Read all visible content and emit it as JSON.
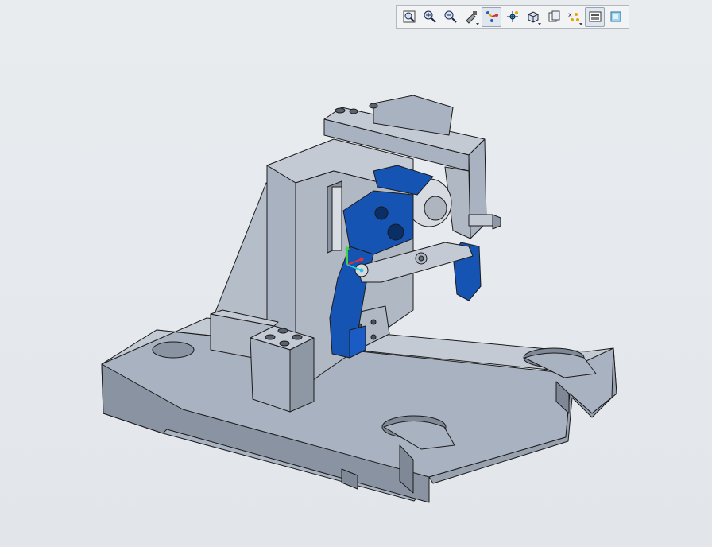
{
  "viewer": {
    "toolbar": [
      {
        "id": "refit",
        "icon": "zoom-fit-icon",
        "has_menu": false,
        "active": false
      },
      {
        "id": "zoom_in",
        "icon": "zoom-in-icon",
        "has_menu": false,
        "active": false
      },
      {
        "id": "zoom_out",
        "icon": "zoom-out-icon",
        "has_menu": false,
        "active": false
      },
      {
        "id": "repaint",
        "icon": "repaint-icon",
        "has_menu": true,
        "active": false
      },
      {
        "id": "display_datums",
        "icon": "datum-display-icon",
        "has_menu": false,
        "active": true
      },
      {
        "id": "spin_center",
        "icon": "spin-center-icon",
        "has_menu": false,
        "active": false
      },
      {
        "id": "display_style",
        "icon": "display-style-cube-icon",
        "has_menu": true,
        "active": false
      },
      {
        "id": "saved_views",
        "icon": "saved-views-icon",
        "has_menu": false,
        "active": false
      },
      {
        "id": "annotation_display",
        "icon": "annotation-display-icon",
        "has_menu": true,
        "active": false
      },
      {
        "id": "view_manager",
        "icon": "view-manager-icon",
        "has_menu": false,
        "active": true
      },
      {
        "id": "appearance",
        "icon": "appearance-icon",
        "has_menu": false,
        "active": false
      }
    ],
    "model": {
      "name": "fixture-assembly",
      "colors": {
        "part": "#a9b2c0",
        "part_dark": "#8a93a1",
        "part_light": "#c3cad4",
        "edge": "#1b1b1b",
        "highlight": "#1654b4"
      }
    }
  }
}
